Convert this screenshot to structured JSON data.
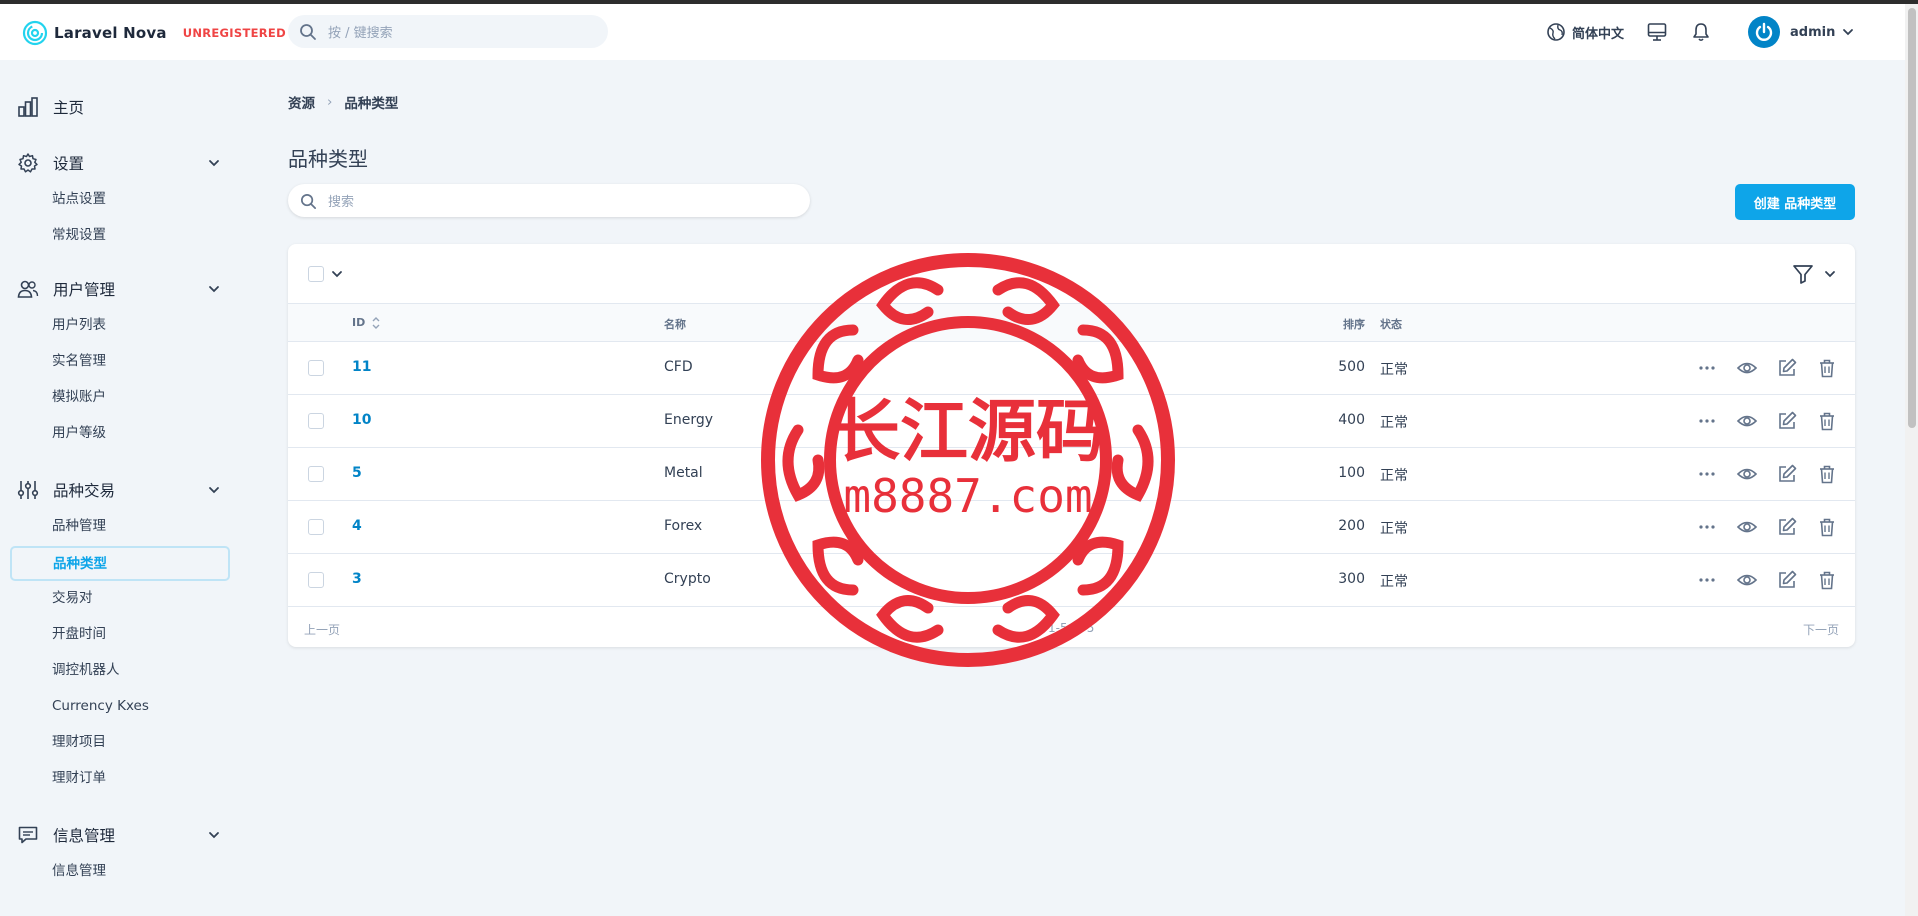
{
  "header": {
    "brand_name": "Laravel Nova",
    "unregistered": "UNREGISTERED",
    "search_placeholder": "按 / 键搜索",
    "language": "简体中文",
    "username": "admin"
  },
  "sidebar": {
    "home": "主页",
    "settings": {
      "label": "设置",
      "items": [
        "站点设置",
        "常规设置"
      ]
    },
    "users": {
      "label": "用户管理",
      "items": [
        "用户列表",
        "实名管理",
        "模拟账户",
        "用户等级"
      ]
    },
    "trading": {
      "label": "品种交易",
      "items": [
        "品种管理",
        "品种类型",
        "交易对",
        "开盘时间",
        "调控机器人",
        "Currency Kxes",
        "理财项目",
        "理财订单"
      ]
    },
    "info": {
      "label": "信息管理",
      "items": [
        "信息管理"
      ]
    }
  },
  "breadcrumb": {
    "root": "资源",
    "current": "品种类型"
  },
  "page": {
    "title": "品种类型",
    "search_placeholder": "搜索",
    "create_button": "创建 品种类型"
  },
  "table": {
    "columns": {
      "id": "ID",
      "name": "名称",
      "sort": "排序",
      "status": "状态"
    },
    "rows": [
      {
        "id": "11",
        "name": "CFD",
        "sort": "500",
        "status": "正常"
      },
      {
        "id": "10",
        "name": "Energy",
        "sort": "400",
        "status": "正常"
      },
      {
        "id": "5",
        "name": "Metal",
        "sort": "100",
        "status": "正常"
      },
      {
        "id": "4",
        "name": "Forex",
        "sort": "200",
        "status": "正常"
      },
      {
        "id": "3",
        "name": "Crypto",
        "sort": "300",
        "status": "正常"
      }
    ],
    "pagination": {
      "prev": "上一页",
      "info": "1-5 of 5",
      "next": "下一页"
    }
  },
  "watermark": {
    "line1": "长江源码",
    "line2": "m8887.com",
    "color": "#e8303a"
  },
  "colors": {
    "accent": "#0ea5e9",
    "link": "#0284c7",
    "danger": "#ef4444"
  }
}
